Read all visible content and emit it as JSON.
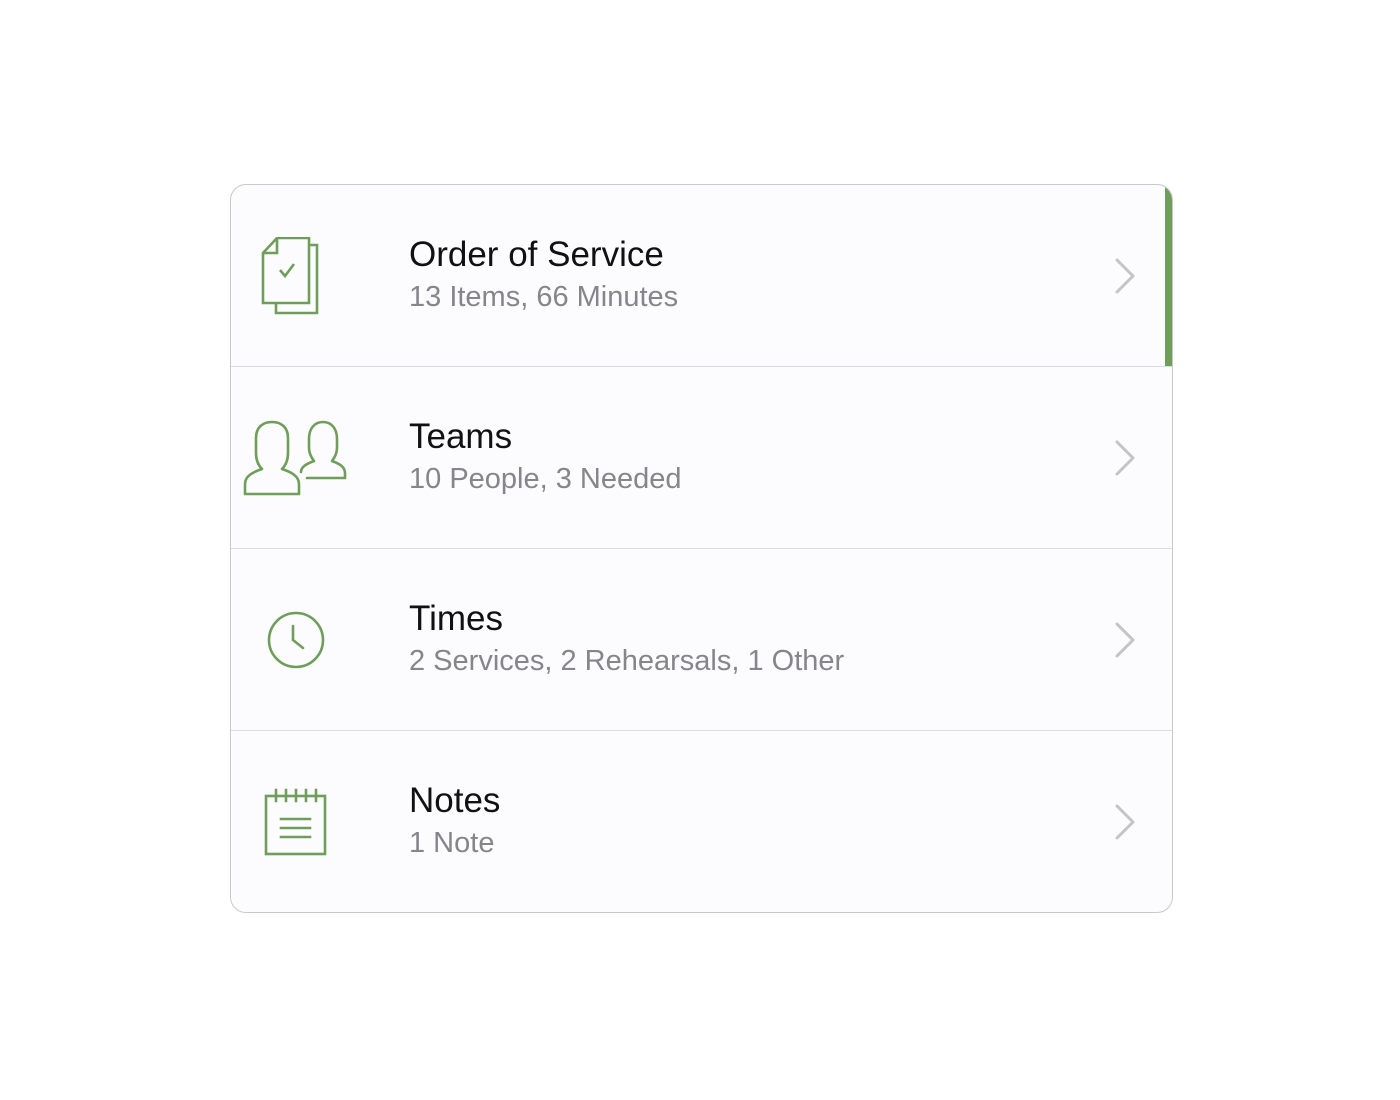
{
  "colors": {
    "accent": "#6f9e5b",
    "title": "#111111",
    "subtitle": "#85858b",
    "chevron": "#c4c4c8"
  },
  "rows": [
    {
      "icon": "documents-check-icon",
      "title": "Order of Service",
      "subtitle": "13 Items, 66 Minutes",
      "selected": true
    },
    {
      "icon": "people-icon",
      "title": "Teams",
      "subtitle": "10 People, 3 Needed",
      "selected": false
    },
    {
      "icon": "clock-icon",
      "title": "Times",
      "subtitle": "2 Services, 2 Rehearsals, 1 Other",
      "selected": false
    },
    {
      "icon": "notepad-icon",
      "title": "Notes",
      "subtitle": "1 Note",
      "selected": false
    }
  ]
}
